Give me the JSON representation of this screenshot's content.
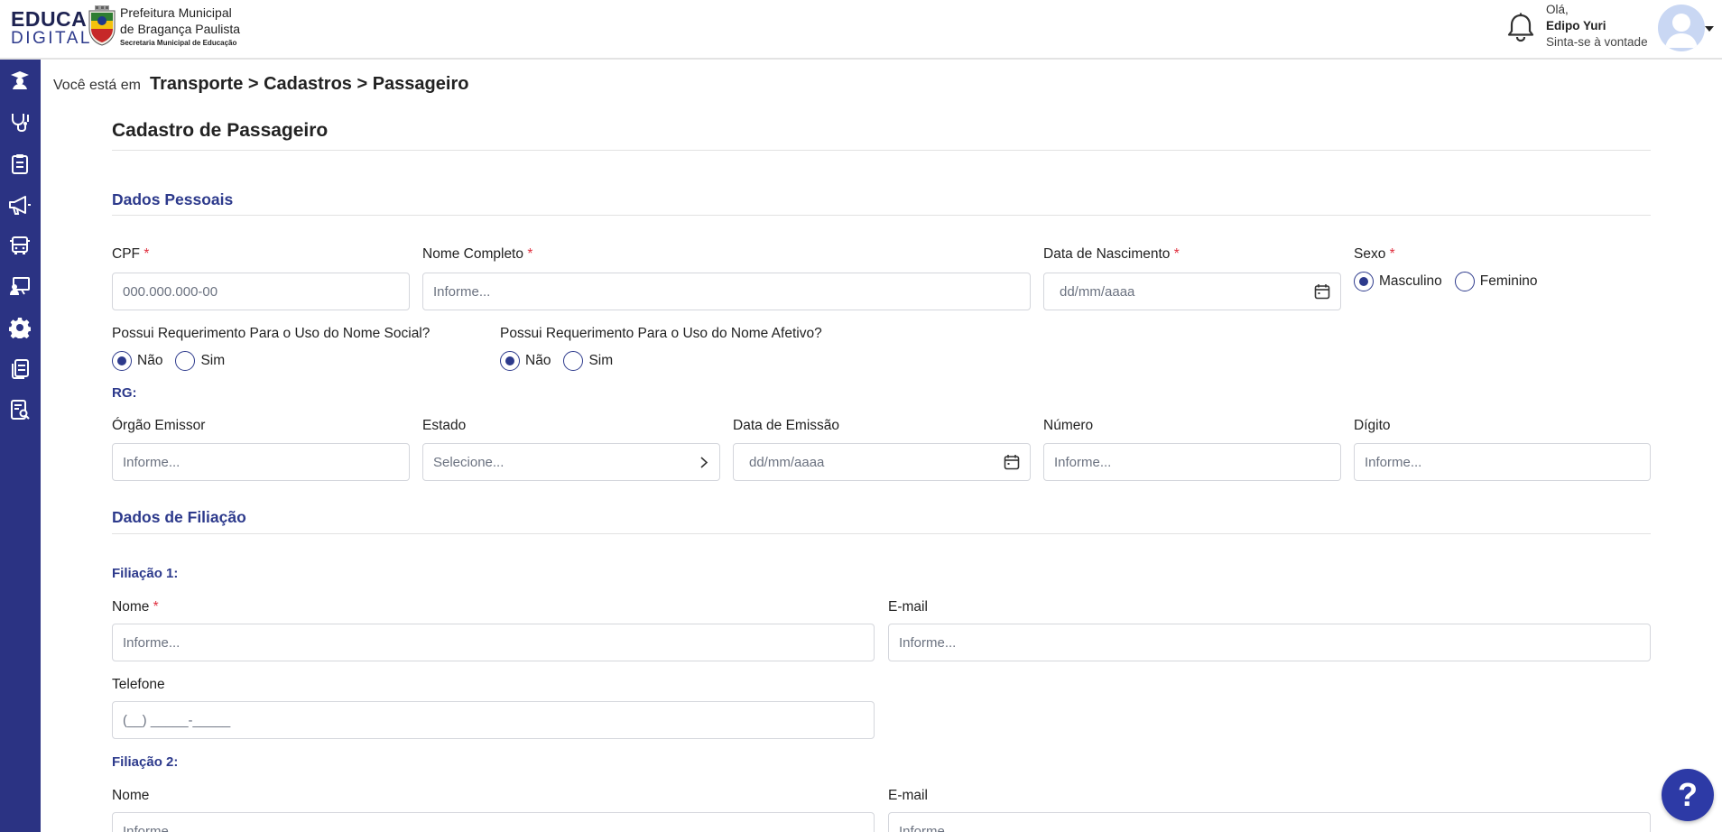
{
  "header": {
    "logo_line1": "EDUCA",
    "logo_line2": "DIGITAL",
    "org_line1": "Prefeitura Municipal",
    "org_line2": "de Bragança Paulista",
    "org_line3": "Secretaria Municipal de Educação",
    "greeting": "Olá,",
    "user_name": "Edipo Yuri",
    "user_subtitle": "Sinta-se à vontade"
  },
  "sidebar": {
    "items": [
      {
        "icon": "graduation-icon"
      },
      {
        "icon": "transport-stethoscope-icon"
      },
      {
        "icon": "clipboard-icon"
      },
      {
        "icon": "megaphone-icon"
      },
      {
        "icon": "bus-icon"
      },
      {
        "icon": "teacher-board-icon"
      },
      {
        "icon": "gear-icon"
      },
      {
        "icon": "documents-icon"
      },
      {
        "icon": "report-search-icon"
      }
    ]
  },
  "breadcrumb": {
    "prefix": "Você está em",
    "path": "Transporte > Cadastros > Passageiro"
  },
  "page_title": "Cadastro de Passageiro",
  "sections": {
    "personal": "Dados Pessoais",
    "filiation": "Dados de Filiação"
  },
  "personal": {
    "cpf_label": "CPF",
    "cpf_placeholder": "000.000.000-00",
    "name_label": "Nome Completo",
    "name_placeholder": "Informe...",
    "birth_label": "Data de Nascimento",
    "birth_placeholder": "dd/mm/aaaa",
    "sex_label": "Sexo",
    "sex_options": [
      "Masculino",
      "Feminino"
    ],
    "sex_selected": "Masculino",
    "social_name_question": "Possui Requerimento Para o Uso do Nome Social?",
    "affective_name_question": "Possui Requerimento Para o Uso do Nome Afetivo?",
    "yes_no": [
      "Não",
      "Sim"
    ],
    "social_selected": "Não",
    "affective_selected": "Não",
    "required_mark": "*"
  },
  "rg": {
    "title": "RG:",
    "issuer_label": "Órgão Emissor",
    "issuer_placeholder": "Informe...",
    "state_label": "Estado",
    "state_placeholder": "Selecione...",
    "issue_date_label": "Data de Emissão",
    "issue_date_placeholder": "dd/mm/aaaa",
    "number_label": "Número",
    "number_placeholder": "Informe...",
    "digit_label": "Dígito",
    "digit_placeholder": "Informe..."
  },
  "filiation1": {
    "title": "Filiação 1:",
    "name_label": "Nome",
    "name_placeholder": "Informe...",
    "email_label": "E-mail",
    "email_placeholder": "Informe...",
    "phone_label": "Telefone",
    "phone_placeholder": "(__) _____-_____"
  },
  "filiation2": {
    "title": "Filiação 2:",
    "name_label": "Nome",
    "name_placeholder": "Informe...",
    "email_label": "E-mail",
    "email_placeholder": "Informe..."
  },
  "help_label": "?",
  "colors": {
    "sidebar": "#2b3383",
    "accent": "#2d3a8c",
    "required": "#e0303f"
  }
}
